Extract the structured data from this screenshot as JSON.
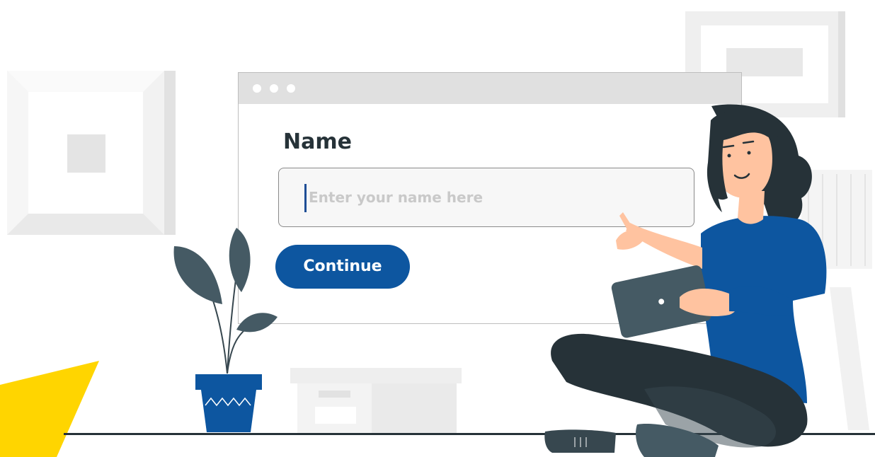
{
  "window": {
    "titlebar_dots": 3
  },
  "form": {
    "name_label": "Name",
    "name_input": {
      "value": "",
      "placeholder": "Enter your name here"
    },
    "continue_label": "Continue"
  },
  "colors": {
    "primary": "#0d56a0",
    "label_text": "#263238",
    "placeholder_text": "#c9c9c9",
    "input_background": "#f7f7f7",
    "accent_yellow": "#ffd500"
  },
  "illustration": {
    "elements": [
      "picture-frame-left",
      "picture-frame-right",
      "potted-plant",
      "storage-box",
      "woman-with-tablet",
      "floor-line",
      "yellow-shape"
    ]
  }
}
